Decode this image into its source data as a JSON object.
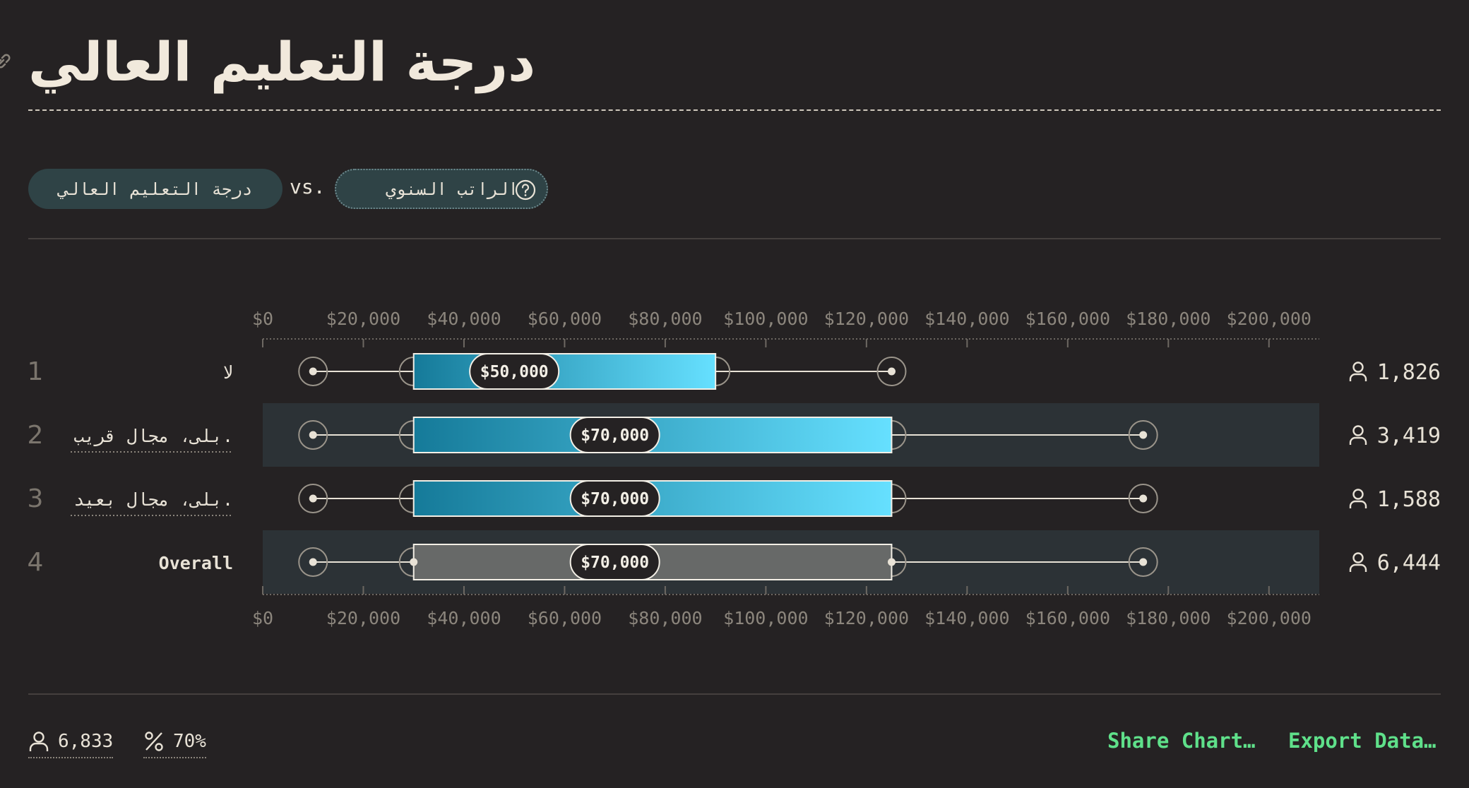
{
  "page": {
    "title": "درجة التعليم العالي",
    "pill_left": "درجة التعليم العالي",
    "vs": "vs.",
    "pill_right": "الراتب السنوي"
  },
  "footer": {
    "respondents": "6,833",
    "percent": "70%",
    "share": "Share Chart…",
    "export": "Export Data…"
  },
  "colors": {
    "background": "#252223",
    "row_highlight": "#2c3236",
    "box_start": "#157a99",
    "box_end": "#66e0ff",
    "overall_box": "#676968",
    "accent_green": "#5fe08a"
  },
  "chart_data": {
    "type": "box",
    "xlim": [
      0,
      210000
    ],
    "ticks": [
      0,
      20000,
      40000,
      60000,
      80000,
      100000,
      120000,
      140000,
      160000,
      180000,
      200000
    ],
    "tick_labels": [
      "$0",
      "$20,000",
      "$40,000",
      "$60,000",
      "$80,000",
      "$100,000",
      "$120,000",
      "$140,000",
      "$160,000",
      "$180,000",
      "$200,000"
    ],
    "rows": [
      {
        "rank": "1",
        "label": "لا",
        "min": 10000,
        "q1": 30000,
        "median": 50000,
        "q3": 90000,
        "max": 125000,
        "median_label": "$50,000",
        "count": "1,826",
        "overall": false
      },
      {
        "rank": "2",
        "label": "بلى، مجال قريب.",
        "min": 10000,
        "q1": 30000,
        "median": 70000,
        "q3": 125000,
        "max": 175000,
        "median_label": "$70,000",
        "count": "3,419",
        "overall": false
      },
      {
        "rank": "3",
        "label": "بلى، مجال بعيد.",
        "min": 10000,
        "q1": 30000,
        "median": 70000,
        "q3": 125000,
        "max": 175000,
        "median_label": "$70,000",
        "count": "1,588",
        "overall": false
      },
      {
        "rank": "4",
        "label": "Overall",
        "min": 10000,
        "q1": 30000,
        "median": 70000,
        "q3": 125000,
        "max": 175000,
        "median_label": "$70,000",
        "count": "6,444",
        "overall": true
      }
    ]
  }
}
